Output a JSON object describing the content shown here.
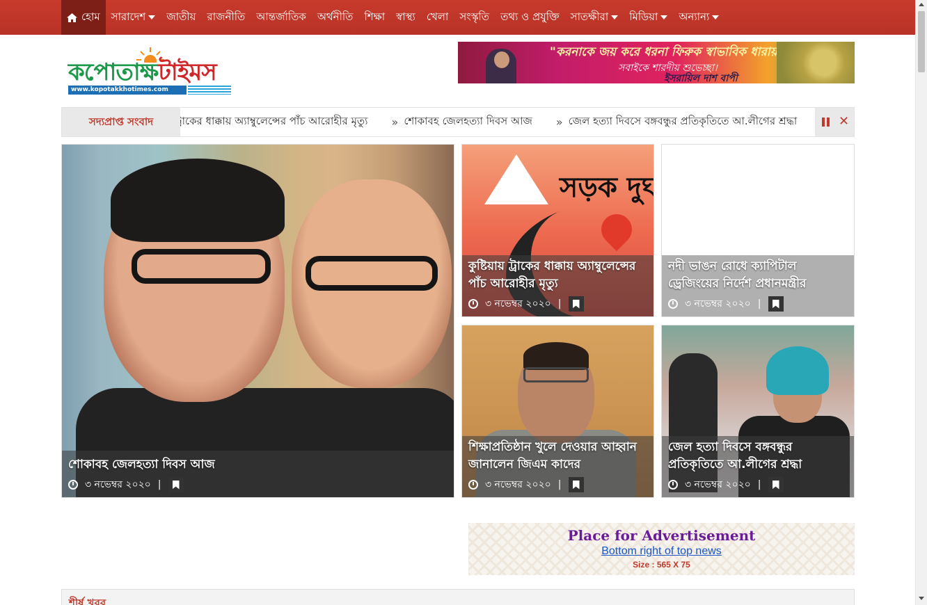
{
  "nav": {
    "items": [
      {
        "label": "হোম",
        "has_caret": false
      },
      {
        "label": "সারাদেশ",
        "has_caret": true
      },
      {
        "label": "জাতীয়",
        "has_caret": false
      },
      {
        "label": "রাজনীতি",
        "has_caret": false
      },
      {
        "label": "আন্তর্জাতিক",
        "has_caret": false
      },
      {
        "label": "অর্থনীতি",
        "has_caret": false
      },
      {
        "label": "শিক্ষা",
        "has_caret": false
      },
      {
        "label": "স্বাস্থ্য",
        "has_caret": false
      },
      {
        "label": "খেলা",
        "has_caret": false
      },
      {
        "label": "সংস্কৃতি",
        "has_caret": false
      },
      {
        "label": "তথ্য ও প্রযুক্তি",
        "has_caret": false
      },
      {
        "label": "সাতক্ষীরা",
        "has_caret": true
      },
      {
        "label": "মিডিয়া",
        "has_caret": true
      },
      {
        "label": "অন্যান্য",
        "has_caret": true
      }
    ],
    "home_icon": "home-icon"
  },
  "logo": {
    "name_green": "কপোতাক্ষ",
    "name_red": "টাইমস",
    "url": "www.kopotakkhotimes.com"
  },
  "top_ad": {
    "line1": "\"করনাকে জয় করে ধরনা ফিরুক স্বাভাবিক ধারায়\"",
    "line2": "সবাইকে শারদীয় শুভেচ্ছা।",
    "line3": "ইসরায়িল দাশ বাপী"
  },
  "ticker": {
    "label": "সদ্যপ্রাপ্ত সংবাদ",
    "items": [
      "ট্রাকের ধাক্কায় অ্যাম্বুলেন্সের পাঁচ আরোহীর মৃত্যু",
      "শোকাবহ জেলহত্যা দিবস আজ",
      "জেল হত্যা দিবসে বঙ্গবন্ধুর প্রতিকৃতিতে আ.লীগের শ্রদ্ধা"
    ]
  },
  "cards": [
    {
      "title": "শোকাবহ জেলহত্যা দিবস আজ",
      "date": "৩ নভেম্বর ২০২০"
    },
    {
      "title": "কুষ্টিয়ায় ট্রাকের ধাক্কায় অ্যাম্বুলেন্সের পাঁচ আরোহীর মৃত্যু",
      "date": "৩ নভেম্বর ২০২০"
    },
    {
      "title": "নদী ভাঙন রোধে ক্যাপিটাল ড্রেজিংয়ের নির্দেশ প্রধানমন্ত্রীর",
      "date": "৩ নভেম্বর ২০২০"
    },
    {
      "title": "শিক্ষাপ্রতিষ্ঠান খুলে দেওয়ার আহ্বান জানালেন জিএম কাদের",
      "date": "৩ নভেম্বর ২০২০"
    },
    {
      "title": "জেল হত্যা দিবসে বঙ্গবন্ধুর প্রতিকৃতিতে আ.লীগের শ্রদ্ধা",
      "date": "৩ নভেম্বর ২০২০"
    }
  ],
  "road_image_text": "সড়ক দুর্ঘ",
  "bottom_ad": {
    "title": "Place for Advertisement",
    "subtitle": "Bottom right of top news",
    "size": "Size : 565 X 75"
  },
  "section": {
    "title": "শীর্ষ খবর"
  },
  "colors": {
    "nav_bg": "#c0392b",
    "accent": "#c0392b",
    "logo_green": "#1a9a48"
  }
}
